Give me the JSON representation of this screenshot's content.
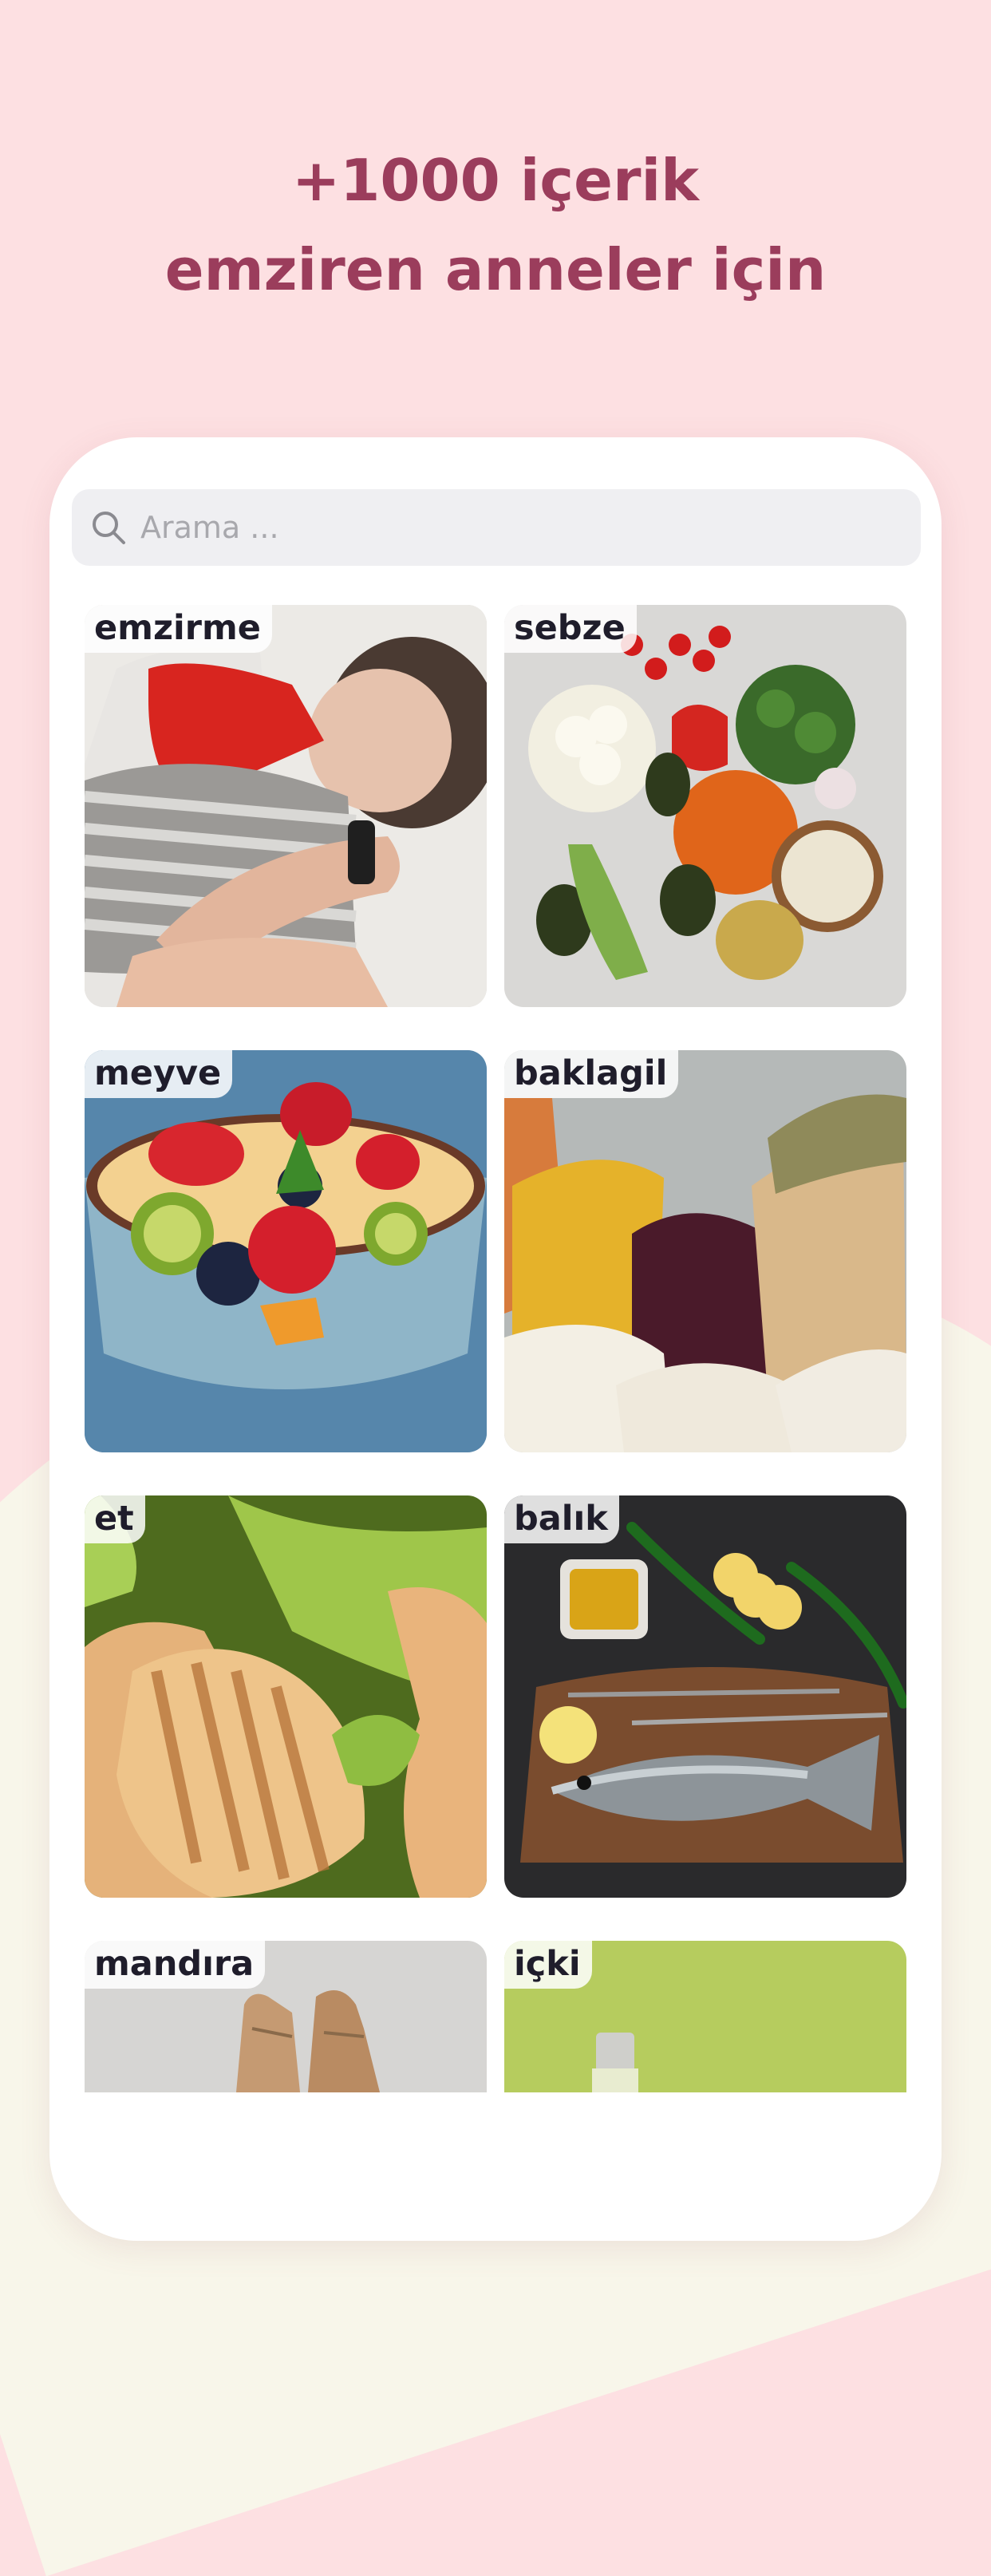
{
  "headline": {
    "line1": "+1000 içerik",
    "line2": "emziren anneler için"
  },
  "search": {
    "placeholder": "Arama ...",
    "icon": "search-icon"
  },
  "categories": [
    {
      "label": "emzirme"
    },
    {
      "label": "sebze"
    },
    {
      "label": "meyve"
    },
    {
      "label": "baklagil"
    },
    {
      "label": "et"
    },
    {
      "label": "balık"
    },
    {
      "label": "mandıra"
    },
    {
      "label": "içki"
    }
  ],
  "colors": {
    "background": "#fde0e2",
    "headline": "#9b3d5c",
    "tag_text": "#1f1d2b"
  }
}
